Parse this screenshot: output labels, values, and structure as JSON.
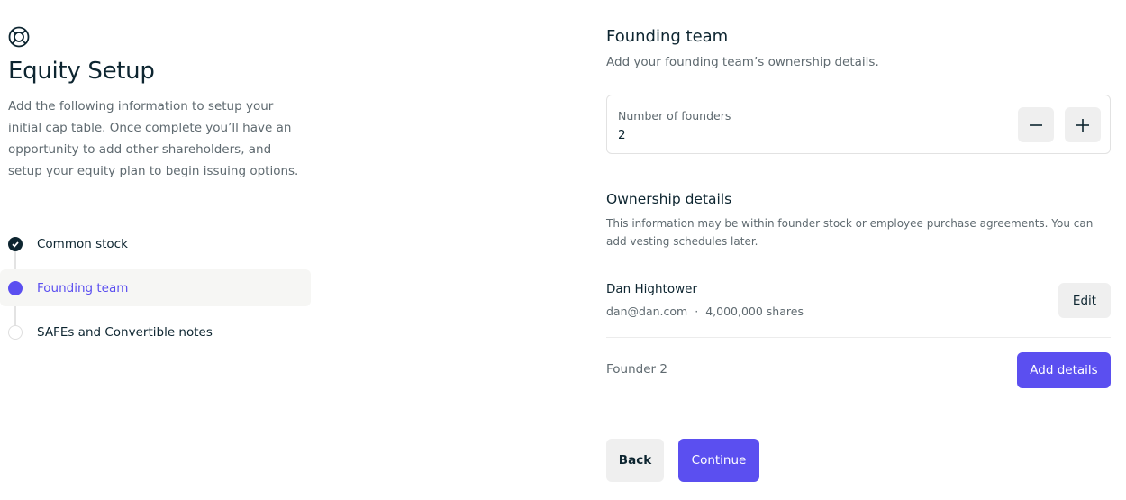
{
  "app": {
    "title": "Equity Setup",
    "intro": "Add the following information to setup your initial cap table. Once complete you’ll have an opportunity to add other shareholders, and setup your equity plan to begin issuing options."
  },
  "steps": [
    {
      "label": "Common stock",
      "status": "complete"
    },
    {
      "label": "Founding team",
      "status": "current"
    },
    {
      "label": "SAFEs and Convertible notes",
      "status": "pending"
    }
  ],
  "founding_team": {
    "title": "Founding team",
    "subtitle": "Add your founding team’s ownership details.",
    "number_label": "Number of founders",
    "number_value": "2"
  },
  "ownership": {
    "title": "Ownership details",
    "description": "This information may be within founder stock or employee purchase agreements. You can add vesting schedules later.",
    "founders": [
      {
        "name": "Dan Hightower",
        "email": "dan@dan.com",
        "separator": "·",
        "shares": "4,000,000 shares",
        "action": "Edit"
      },
      {
        "name": "Founder 2",
        "action": "Add details"
      }
    ]
  },
  "footer": {
    "back": "Back",
    "continue": "Continue"
  },
  "colors": {
    "accent": "#5b4ff0",
    "text": "#0d2530",
    "muted": "#5f6a70"
  },
  "icons": {
    "logo": "lifebuoy-icon",
    "complete": "check-icon",
    "minus": "minus-icon",
    "plus": "plus-icon"
  }
}
